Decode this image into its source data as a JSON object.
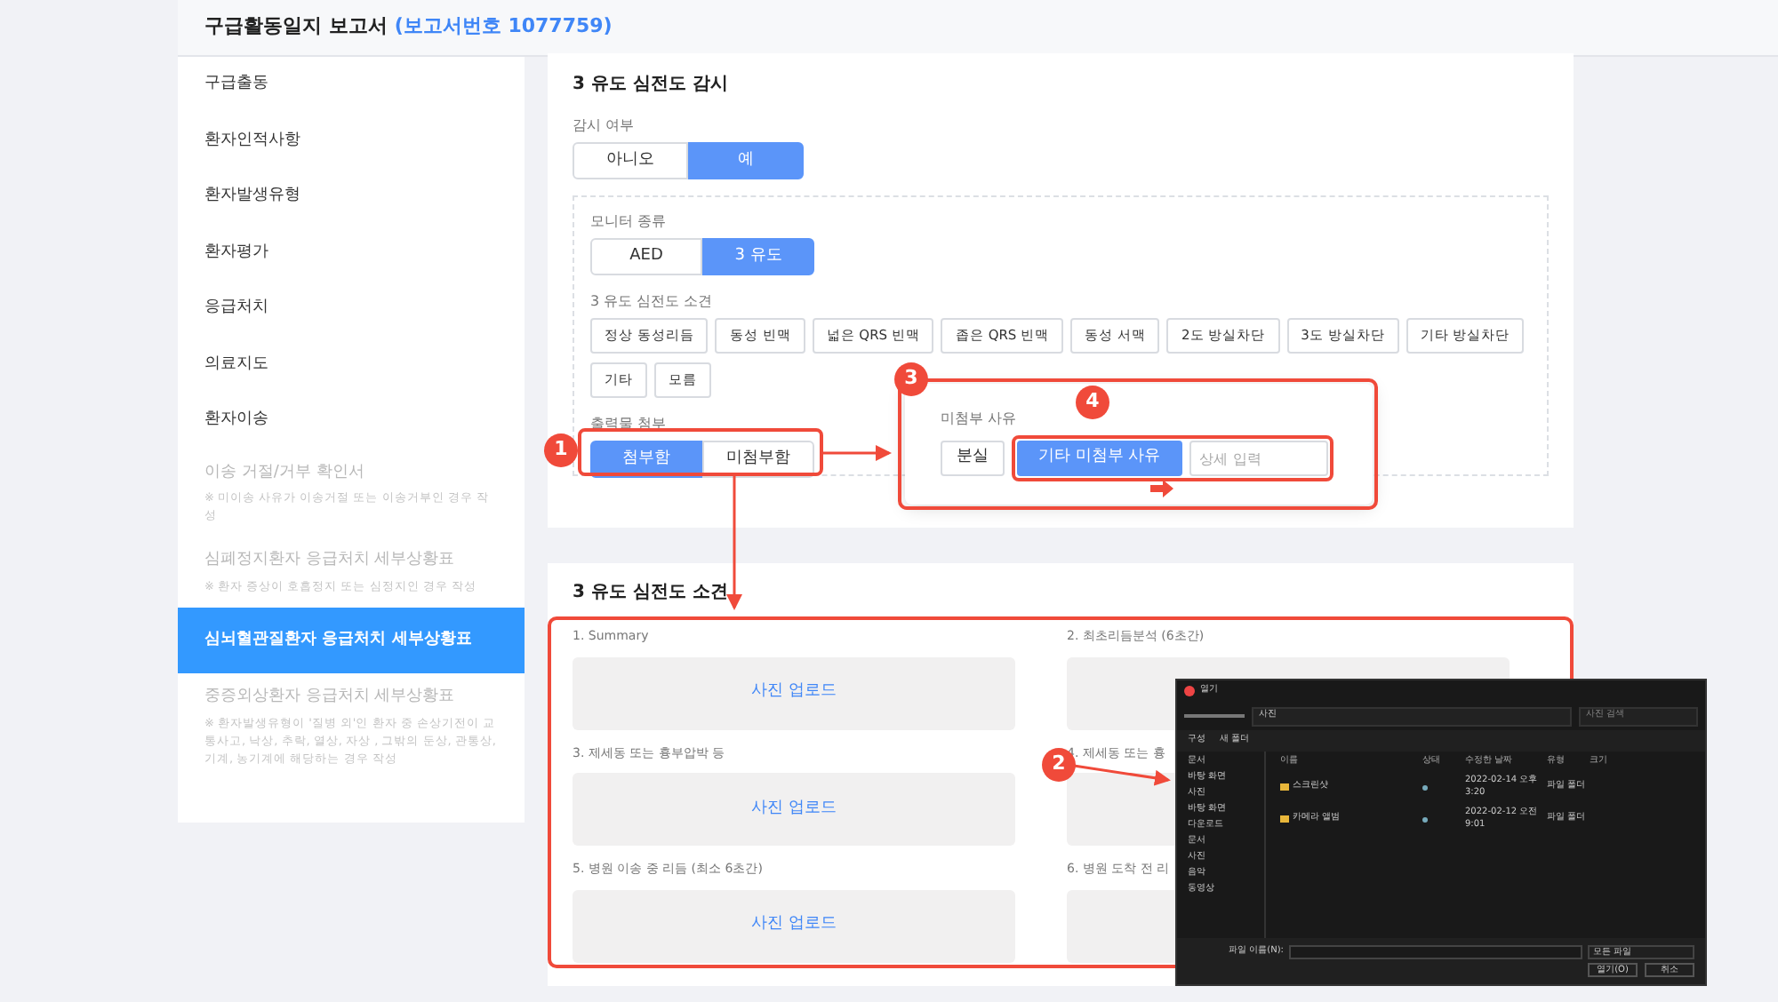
{
  "header": {
    "title": "구급활동일지 보고서",
    "report_no": "(보고서번호 1077759)"
  },
  "sidebar": {
    "items": [
      {
        "label": "구급출동",
        "disabled": false,
        "selected": false
      },
      {
        "label": "환자인적사항",
        "disabled": false,
        "selected": false
      },
      {
        "label": "환자발생유형",
        "disabled": false,
        "selected": false
      },
      {
        "label": "환자평가",
        "disabled": false,
        "selected": false
      },
      {
        "label": "응급처치",
        "disabled": false,
        "selected": false
      },
      {
        "label": "의료지도",
        "disabled": false,
        "selected": false
      },
      {
        "label": "환자이송",
        "disabled": false,
        "selected": false
      },
      {
        "label": "이송 거절/거부 확인서",
        "note": "※ 미이송 사유가 이송거절 또는 이송거부인 경우 작성",
        "disabled": true,
        "selected": false
      },
      {
        "label": "심폐정지환자 응급처치 세부상황표",
        "note": "※ 환자 증상이 호흡정지 또는 심정지인 경우 작성",
        "disabled": true,
        "selected": false
      },
      {
        "label": "심뇌혈관질환자 응급처치 세부상황표",
        "disabled": false,
        "selected": true
      },
      {
        "label": "중증외상환자 응급처치 세부상황표",
        "note": "※ 환자발생유형이 '질병 외'인 환자 중 손상기전이 교통사고, 낙상, 추락, 열상, 자상 , 그밖의 둔상, 관통상, 기계, 농기계에 해당하는 경우 작성",
        "disabled": true,
        "selected": false
      }
    ]
  },
  "monitoring": {
    "title": "3 유도 심전도 감시",
    "watch": {
      "label": "감시 여부",
      "options": [
        {
          "label": "아니오",
          "selected": false
        },
        {
          "label": "예",
          "selected": true
        }
      ]
    },
    "monitor_type": {
      "label": "모니터 종류",
      "options": [
        {
          "label": "AED",
          "selected": false
        },
        {
          "label": "3 유도",
          "selected": true
        }
      ]
    },
    "findings": {
      "label": "3 유도 심전도 소견",
      "options": [
        {
          "label": "정상 동성리듬",
          "selected": false
        },
        {
          "label": "동성 빈맥",
          "selected": false
        },
        {
          "label": "넓은 QRS 빈맥",
          "selected": false
        },
        {
          "label": "좁은 QRS 빈맥",
          "selected": false
        },
        {
          "label": "동성 서맥",
          "selected": false
        },
        {
          "label": "2도 방실차단",
          "selected": false
        },
        {
          "label": "3도 방실차단",
          "selected": false
        },
        {
          "label": "기타 방실차단",
          "selected": false
        },
        {
          "label": "기타",
          "selected": false
        },
        {
          "label": "모름",
          "selected": false
        }
      ]
    },
    "printout": {
      "label": "출력물 첨부",
      "options": [
        {
          "label": "첨부함",
          "selected": true
        },
        {
          "label": "미첨부함",
          "selected": false
        }
      ]
    }
  },
  "popup": {
    "label": "미첨부 사유",
    "options": [
      {
        "label": "분실",
        "selected": false
      },
      {
        "label": "기타 미첨부 사유",
        "selected": true
      }
    ],
    "input": {
      "placeholder": "상세 입력"
    }
  },
  "ecg_findings": {
    "title": "3 유도 심전도 소견",
    "items": [
      {
        "label": "1. Summary",
        "button": "사진 업로드"
      },
      {
        "label": "2. 최초리듬분석 (6초간)"
      },
      {
        "label": "3. 제세동 또는 흉부압박 등",
        "button": "사진 업로드"
      },
      {
        "label": "4. 제세동 또는 흉"
      },
      {
        "label": "5. 병원 이송 중 리듬 (최소 6초간)",
        "button": "사진 업로드"
      },
      {
        "label": "6. 병원 도착 전 리"
      }
    ]
  },
  "markers": [
    "1",
    "2",
    "3",
    "4"
  ],
  "dialog": {
    "title": "열기",
    "path": "사진",
    "search": "사진 검색",
    "toolbar": [
      "구성",
      "새 폴더"
    ],
    "nav": [
      "문서",
      "바탕 화면",
      "사진",
      "바탕 화면",
      "다운로드",
      "문서",
      "사진",
      "음악",
      "동영상"
    ],
    "columns": [
      "이름",
      "상태",
      "수정한 날짜",
      "유형",
      "크기"
    ],
    "files": [
      {
        "name": "스크린샷",
        "date": "2022-02-14 오후 3:20",
        "type": "파일 폴더"
      },
      {
        "name": "카메라 앨범",
        "date": "2022-02-12 오전 9:01",
        "type": "파일 폴더"
      }
    ],
    "filename_label": "파일 이름(N):",
    "filter": "모든 파일",
    "buttons": [
      "열기(O)",
      "취소"
    ]
  }
}
